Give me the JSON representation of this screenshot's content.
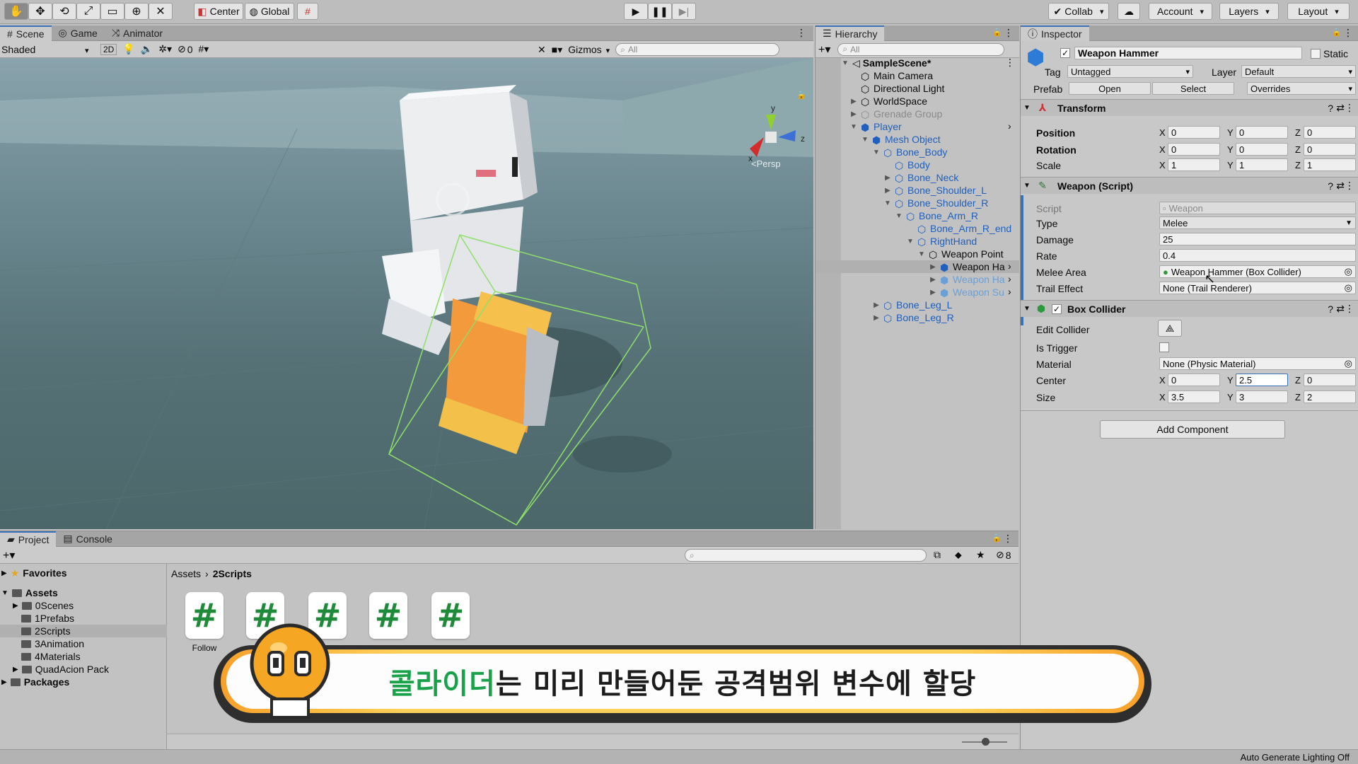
{
  "toolbar": {
    "pivot": "Center",
    "space": "Global",
    "collab": "Collab",
    "account": "Account",
    "layers": "Layers",
    "layout": "Layout"
  },
  "scene": {
    "tabs": [
      "Scene",
      "Game",
      "Animator"
    ],
    "shading": "Shaded",
    "mode_2d": "2D",
    "hidden_count": "0",
    "gizmos": "Gizmos",
    "search_placeholder": "All",
    "persp": "<Persp",
    "axis_y": "y",
    "axis_x": "x",
    "axis_z": "z"
  },
  "hierarchy": {
    "title": "Hierarchy",
    "search_placeholder": "All",
    "items": [
      {
        "label": "SampleScene*"
      },
      {
        "label": "Main Camera"
      },
      {
        "label": "Directional Light"
      },
      {
        "label": "WorldSpace"
      },
      {
        "label": "Grenade Group"
      },
      {
        "label": "Player"
      },
      {
        "label": "Mesh Object"
      },
      {
        "label": "Bone_Body"
      },
      {
        "label": "Body"
      },
      {
        "label": "Bone_Neck"
      },
      {
        "label": "Bone_Shoulder_L"
      },
      {
        "label": "Bone_Shoulder_R"
      },
      {
        "label": "Bone_Arm_R"
      },
      {
        "label": "Bone_Arm_R_end"
      },
      {
        "label": "RightHand"
      },
      {
        "label": "Weapon Point"
      },
      {
        "label": "Weapon Ha"
      },
      {
        "label": "Weapon Ha"
      },
      {
        "label": "Weapon Su"
      },
      {
        "label": "Bone_Leg_L"
      },
      {
        "label": "Bone_Leg_R"
      }
    ]
  },
  "inspector": {
    "title": "Inspector",
    "object_name": "Weapon Hammer",
    "static_label": "Static",
    "tag_label": "Tag",
    "tag_value": "Untagged",
    "layer_label": "Layer",
    "layer_value": "Default",
    "prefab_label": "Prefab",
    "open": "Open",
    "select": "Select",
    "overrides": "Overrides",
    "transform": {
      "title": "Transform",
      "position_label": "Position",
      "rotation_label": "Rotation",
      "scale_label": "Scale",
      "position": {
        "x": "0",
        "y": "0",
        "z": "0"
      },
      "rotation": {
        "x": "0",
        "y": "0",
        "z": "0"
      },
      "scale": {
        "x": "1",
        "y": "1",
        "z": "1"
      }
    },
    "weapon": {
      "title": "Weapon (Script)",
      "script_label": "Script",
      "script_value": "Weapon",
      "type_label": "Type",
      "type_value": "Melee",
      "damage_label": "Damage",
      "damage_value": "25",
      "rate_label": "Rate",
      "rate_value": "0.4",
      "melee_label": "Melee Area",
      "melee_value": "Weapon Hammer (Box Collider)",
      "trail_label": "Trail Effect",
      "trail_value": "None (Trail Renderer)"
    },
    "box": {
      "title": "Box Collider",
      "edit_label": "Edit Collider",
      "trigger_label": "Is Trigger",
      "material_label": "Material",
      "material_value": "None (Physic Material)",
      "center_label": "Center",
      "size_label": "Size",
      "center": {
        "x": "0",
        "y": "2.5",
        "z": "0"
      },
      "size": {
        "x": "3.5",
        "y": "3",
        "z": "2"
      }
    },
    "add_component": "Add Component",
    "axis": {
      "x": "X",
      "y": "Y",
      "z": "Z"
    }
  },
  "project": {
    "tabs": [
      "Project",
      "Console"
    ],
    "hidden_count": "8",
    "favorites": "Favorites",
    "assets": "Assets",
    "folders": [
      "0Scenes",
      "1Prefabs",
      "2Scripts",
      "3Animation",
      "4Materials",
      "QuadAcion Pack"
    ],
    "packages": "Packages",
    "breadcrumb_root": "Assets",
    "breadcrumb_current": "2Scripts",
    "scripts": [
      {
        "symbol": "#",
        "name": "Follow"
      },
      {
        "symbol": "#",
        "name": ""
      },
      {
        "symbol": "#",
        "name": ""
      },
      {
        "symbol": "#",
        "name": ""
      },
      {
        "symbol": "#",
        "name": ""
      }
    ]
  },
  "subtitle": {
    "highlight": "콜라이더",
    "rest": "는 미리 만들어둔 공격범위 변수에 할당"
  },
  "status": "Auto Generate Lighting Off",
  "colors": {
    "accent_blue": "#1e5fbf",
    "script_green": "#1f8a3a",
    "subtitle_green": "#1aa24a",
    "subtitle_border": "#ffd15a",
    "collider_wire": "#8ee06a"
  }
}
